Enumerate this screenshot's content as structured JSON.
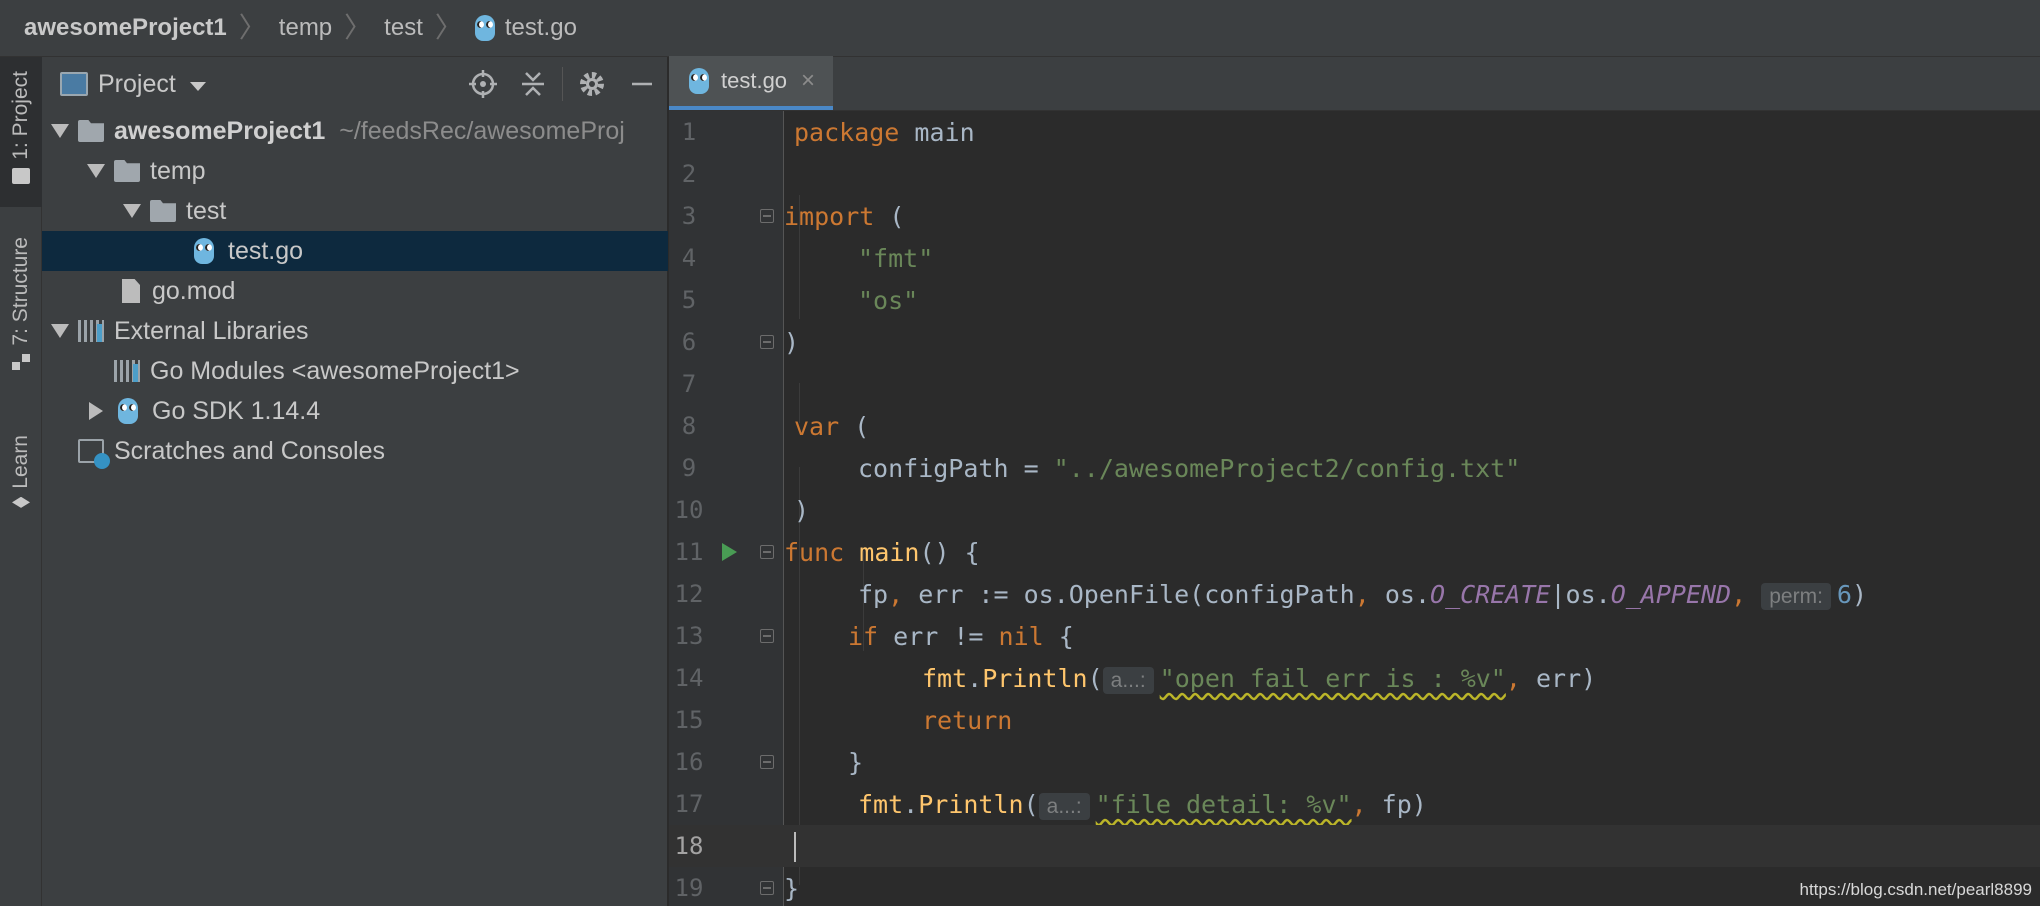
{
  "breadcrumb": {
    "project": "awesomeProject1",
    "folder1": "temp",
    "folder2": "test",
    "file": "test.go"
  },
  "toolstrip": {
    "project_tab": "1: Project",
    "structure_tab": "7: Structure",
    "learn_tab": "Learn"
  },
  "project_panel": {
    "title": "Project",
    "tree": {
      "root_name": "awesomeProject1",
      "root_path": "~/feedsRec/awesomeProj",
      "temp": "temp",
      "test": "test",
      "test_go": "test.go",
      "go_mod": "go.mod",
      "external_libraries": "External Libraries",
      "go_modules": "Go Modules <awesomeProject1>",
      "go_sdk": "Go SDK 1.14.4",
      "scratches": "Scratches and Consoles"
    }
  },
  "editor": {
    "tab_label": "test.go",
    "line_numbers": [
      "1",
      "2",
      "3",
      "4",
      "5",
      "6",
      "7",
      "8",
      "9",
      "10",
      "11",
      "12",
      "13",
      "14",
      "15",
      "16",
      "17",
      "18",
      "19"
    ],
    "current_line": "18",
    "code": {
      "l1_kw": "package",
      "l1_name": "main",
      "l3_kw": "import",
      "l3_paren": "(",
      "l4_str": "\"fmt\"",
      "l5_str": "\"os\"",
      "l6_paren": ")",
      "l8_kw": "var",
      "l8_paren": "(",
      "l9_name": "configPath = ",
      "l9_str": "\"../awesomeProject2/config.txt\"",
      "l10_paren": ")",
      "l11_kw": "func",
      "l11_fn": "main",
      "l11_rest": "() {",
      "l12_a": "fp",
      "l12_b": ", ",
      "l12_c": "err := ",
      "l12_pkg1": "os",
      "l12_dot1": ".",
      "l12_fn": "OpenFile",
      "l12_d": "(configPath",
      "l12_e": ", ",
      "l12_pkg2": "os",
      "l12_dot2": ".",
      "l12_c1": "O_CREATE",
      "l12_bar": "|",
      "l12_pkg3": "os",
      "l12_dot3": ".",
      "l12_c2": "O_APPEND",
      "l12_f": ", ",
      "l12_hint": "perm:",
      "l12_num": "6",
      "l12_end": ")",
      "l13_kw": "if",
      "l13_mid": " err != ",
      "l13_nil": "nil",
      "l13_end": " {",
      "l14_pkg": "fmt",
      "l14_dot": ".",
      "l14_fn": "Println",
      "l14_open": "(",
      "l14_hint": "a...:",
      "l14_str": "\"open fail err is : %v\"",
      "l14_comma": ", ",
      "l14_end": "err)",
      "l15_kw": "return",
      "l16_brace": "}",
      "l17_pkg": "fmt",
      "l17_dot": ".",
      "l17_fn": "Println",
      "l17_open": "(",
      "l17_hint": "a...:",
      "l17_str": "\"file detail: %v\"",
      "l17_comma": ", ",
      "l17_end": "fp)",
      "l19_brace": "}"
    }
  },
  "watermark": "https://blog.csdn.net/pearl8899"
}
